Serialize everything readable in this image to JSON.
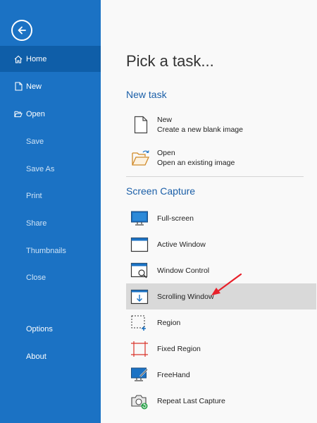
{
  "sidebar": {
    "items": [
      {
        "label": "Home"
      },
      {
        "label": "New"
      },
      {
        "label": "Open"
      },
      {
        "label": "Save"
      },
      {
        "label": "Save As"
      },
      {
        "label": "Print"
      },
      {
        "label": "Share"
      },
      {
        "label": "Thumbnails"
      },
      {
        "label": "Close"
      },
      {
        "label": "Options"
      },
      {
        "label": "About"
      }
    ]
  },
  "main": {
    "title": "Pick a task...",
    "new_task": {
      "heading": "New task",
      "items": [
        {
          "title": "New",
          "desc": "Create a new blank image"
        },
        {
          "title": "Open",
          "desc": "Open an existing image"
        }
      ]
    },
    "screen_capture": {
      "heading": "Screen Capture",
      "items": [
        {
          "label": "Full-screen"
        },
        {
          "label": "Active Window"
        },
        {
          "label": "Window Control"
        },
        {
          "label": "Scrolling Window"
        },
        {
          "label": "Region"
        },
        {
          "label": "Fixed Region"
        },
        {
          "label": "FreeHand"
        },
        {
          "label": "Repeat Last Capture"
        }
      ]
    }
  },
  "colors": {
    "sidebar_bg": "#1b72c4",
    "sidebar_active": "#0f5ea8",
    "accent_heading": "#1b5fa8",
    "selected_row": "#d9d9d9",
    "annotation_arrow": "#e8202a"
  }
}
